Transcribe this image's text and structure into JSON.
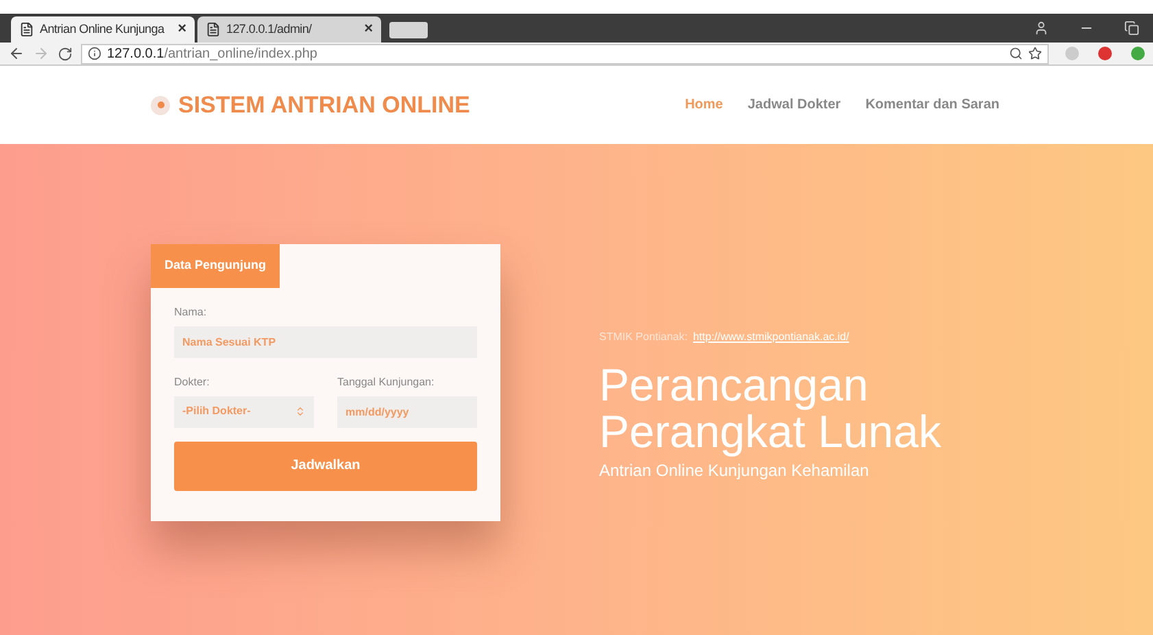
{
  "browser": {
    "tabs": [
      {
        "title": "Antrian Online Kunjunga",
        "selected": true
      },
      {
        "title": "127.0.0.1/admin/",
        "selected": false
      }
    ],
    "close_glyph": "×",
    "url_host": "127.0.0.1",
    "url_path": "/antrian_online/index.php"
  },
  "header": {
    "logo": "SISTEM ANTRIAN ONLINE",
    "nav": [
      {
        "label": "Home",
        "selected": true
      },
      {
        "label": "Jadwal Dokter",
        "selected": false
      },
      {
        "label": "Komentar dan Saran",
        "selected": false
      }
    ]
  },
  "form": {
    "tab": "Data Pengunjung",
    "name_label": "Nama:",
    "name_placeholder": "Nama Sesuai KTP",
    "doctor_label": "Dokter:",
    "doctor_value": "-Pilih Dokter-",
    "date_label": "Tanggal Kunjungan:",
    "date_placeholder": "mm/dd/yyyy",
    "submit": "Jadwalkan"
  },
  "hero": {
    "source_label": "STMIK Pontianak:",
    "source_link": "http://www.stmikpontianak.ac.id/",
    "title_lines": [
      "Perancangan",
      "Perangkat Lunak"
    ],
    "subtitle": "Antrian Online Kunjungan Kehamilan"
  }
}
